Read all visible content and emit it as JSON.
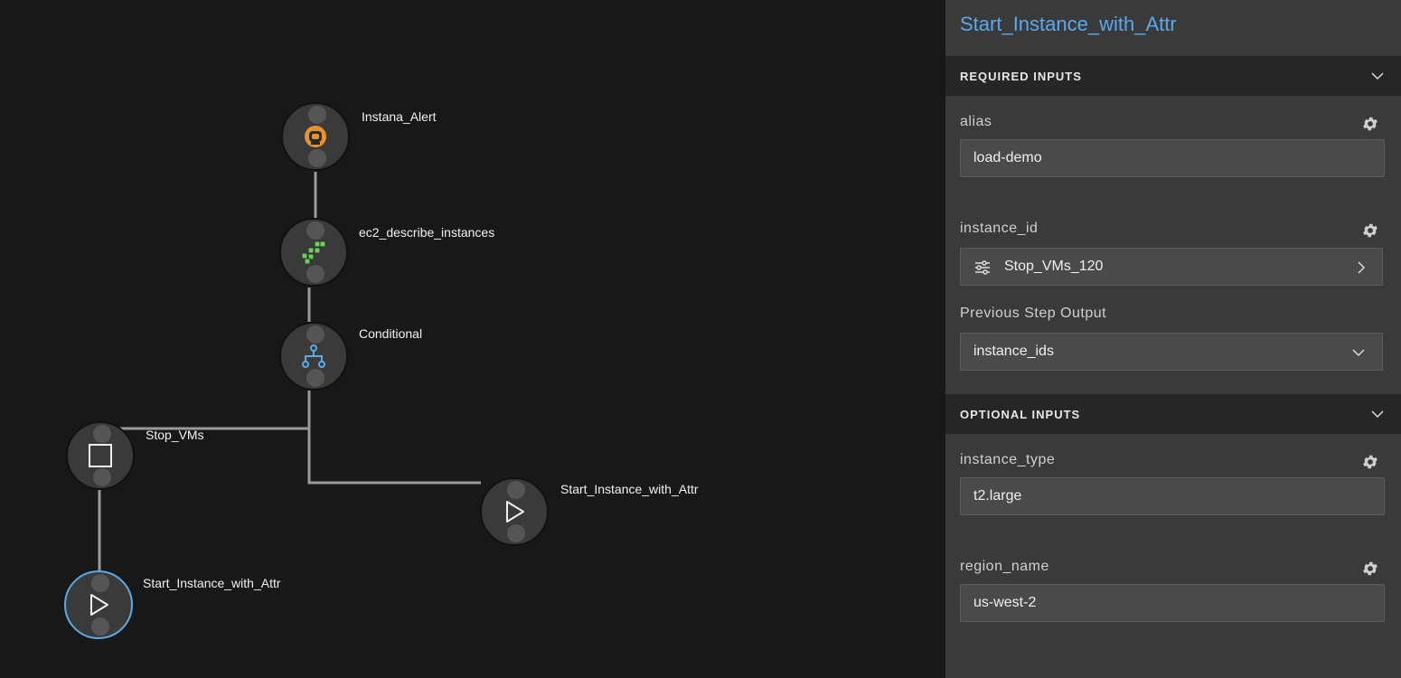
{
  "workflow": {
    "nodes": {
      "instana_alert": {
        "label": "Instana_Alert",
        "icon": "instana-robot-icon",
        "color": "#e8912e"
      },
      "ec2_describe": {
        "label": "ec2_describe_instances",
        "icon": "aws-cubes-icon",
        "color": "#6ccd5c"
      },
      "conditional": {
        "label": "Conditional",
        "icon": "branch-icon",
        "color": "#5aabe6"
      },
      "stop_vms": {
        "label": "Stop_VMs",
        "icon": "stop-square-icon"
      },
      "start_instance_right": {
        "label": "Start_Instance_with_Attr",
        "icon": "play-icon"
      },
      "start_instance_selected": {
        "label": "Start_Instance_with_Attr",
        "icon": "play-icon",
        "selected": true
      }
    }
  },
  "panel": {
    "title": "Start_Instance_with_Attr",
    "required_inputs": {
      "header": "REQUIRED INPUTS",
      "alias": {
        "label": "alias",
        "value": "load-demo"
      },
      "instance_id": {
        "label": "instance_id",
        "reference": "Stop_VMs_120",
        "output_label": "Previous Step Output",
        "output_value": "instance_ids"
      }
    },
    "optional_inputs": {
      "header": "OPTIONAL INPUTS",
      "instance_type": {
        "label": "instance_type",
        "value": "t2.large"
      },
      "region_name": {
        "label": "region_name",
        "value": "us-west-2"
      }
    }
  },
  "colors": {
    "accent": "#5aa8ee",
    "selected_ring": "#5aabe6",
    "edge": "#9a9a9a"
  }
}
